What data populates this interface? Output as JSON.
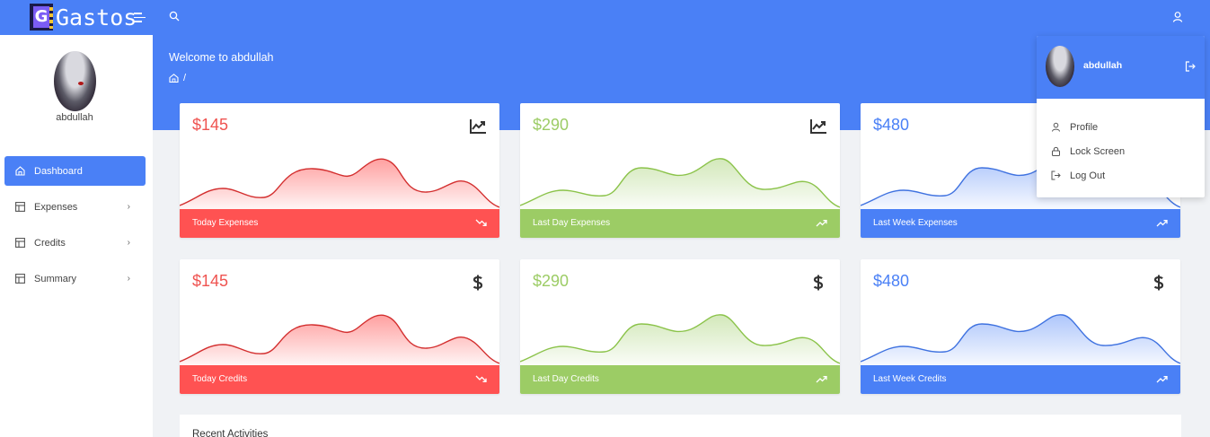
{
  "app": {
    "logo_text": "Gastos",
    "logo_letter": "G"
  },
  "user": {
    "name": "abdullah"
  },
  "sidebar": {
    "items": [
      {
        "label": "Dashboard",
        "active": true,
        "icon": "home-icon"
      },
      {
        "label": "Expenses",
        "icon": "layout-icon"
      },
      {
        "label": "Credits",
        "icon": "layout-icon"
      },
      {
        "label": "Summary",
        "icon": "layout-icon"
      }
    ]
  },
  "header": {
    "welcome": "Welcome to abdullah",
    "breadcrumb_sep": "/"
  },
  "cards": [
    {
      "amount": "$145",
      "label": "Today Expenses",
      "theme": "red",
      "icon": "trend-chart-icon",
      "foot_icon": "trending-down-icon"
    },
    {
      "amount": "$290",
      "label": "Last Day Expenses",
      "theme": "green",
      "icon": "trend-chart-icon",
      "foot_icon": "trending-up-icon"
    },
    {
      "amount": "$480",
      "label": "Last Week Expenses",
      "theme": "blue",
      "icon": "trend-chart-icon",
      "foot_icon": "trending-up-icon"
    },
    {
      "amount": "$145",
      "label": "Today Credits",
      "theme": "red",
      "icon": "dollar-icon",
      "foot_icon": "trending-down-icon"
    },
    {
      "amount": "$290",
      "label": "Last Day Credits",
      "theme": "green",
      "icon": "dollar-icon",
      "foot_icon": "trending-up-icon"
    },
    {
      "amount": "$480",
      "label": "Last Week Credits",
      "theme": "blue",
      "icon": "dollar-icon",
      "foot_icon": "trending-up-icon"
    }
  ],
  "recent": {
    "title": "Recent Activities"
  },
  "dropdown": {
    "name": "abdullah",
    "items": [
      {
        "label": "Profile",
        "icon": "user-icon"
      },
      {
        "label": "Lock Screen",
        "icon": "lock-icon"
      },
      {
        "label": "Log Out",
        "icon": "logout-icon"
      }
    ]
  },
  "colors": {
    "primary": "#4a80f6",
    "red": "#ff5252",
    "green": "#9ccc65",
    "background": "#f0f2f5"
  }
}
